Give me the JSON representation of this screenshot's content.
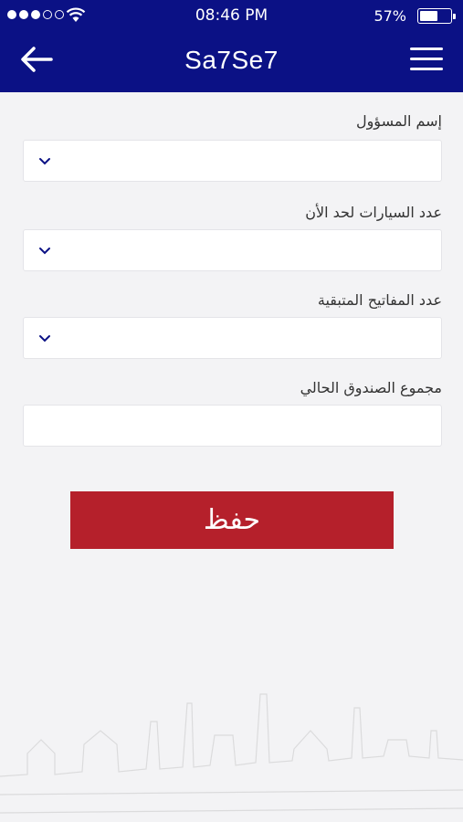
{
  "status_bar": {
    "time": "08:46 PM",
    "battery": "57%"
  },
  "header": {
    "title": "Sa7Se7",
    "back_icon": "arrow-left-icon",
    "menu_icon": "hamburger-menu-icon"
  },
  "colors": {
    "header_bg": "#0b1185",
    "button_bg": "#b5202b",
    "chevron": "#0b1185"
  },
  "form": {
    "fields": [
      {
        "label": "إسم المسؤول",
        "type": "select",
        "value": ""
      },
      {
        "label": "عدد السيارات لحد الأن",
        "type": "select",
        "value": ""
      },
      {
        "label": "عدد المفاتيح المتبقية",
        "type": "select",
        "value": ""
      },
      {
        "label": "مجموع الصندوق الحالي",
        "type": "input",
        "value": ""
      }
    ],
    "save_label": "حفظ"
  }
}
